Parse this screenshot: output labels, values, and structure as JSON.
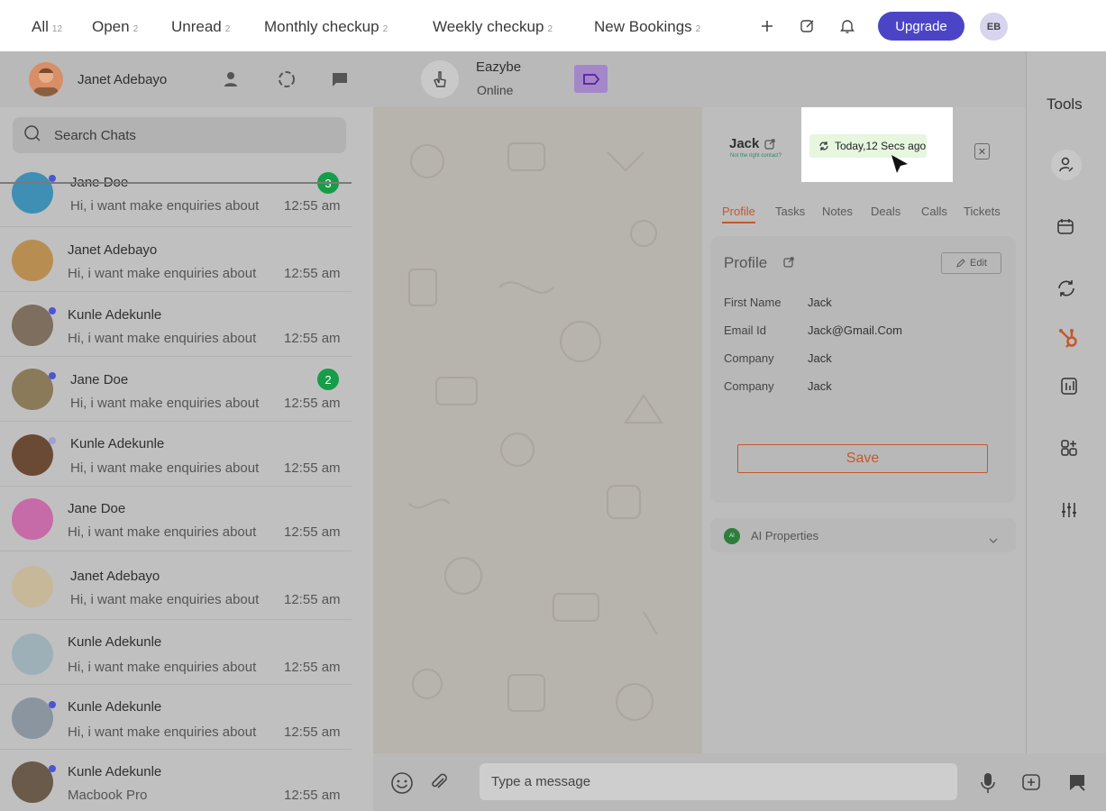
{
  "tabs": [
    {
      "label": "All",
      "count": "12"
    },
    {
      "label": "Open",
      "count": "2"
    },
    {
      "label": "Unread",
      "count": "2"
    },
    {
      "label": "Monthly checkup",
      "count": "2"
    },
    {
      "label": "Weekly checkup",
      "count": "2"
    },
    {
      "label": "New Bookings",
      "count": "2"
    }
  ],
  "topbar": {
    "upgrade_label": "Upgrade",
    "avatar_initials": "EB"
  },
  "header": {
    "user_name": "Janet Adebayo",
    "contact_name": "Eazybe",
    "contact_status": "Online"
  },
  "search": {
    "placeholder": "Search Chats"
  },
  "chats": [
    {
      "name": "Jane Doe",
      "message": "Hi, i want make enquiries about",
      "time": "12:55 am",
      "unread": "3"
    },
    {
      "name": "Janet Adebayo",
      "message": "Hi, i want make enquiries about",
      "time": "12:55 am",
      "unread": ""
    },
    {
      "name": "Kunle Adekunle",
      "message": "Hi, i want make enquiries about",
      "time": "12:55 am",
      "unread": ""
    },
    {
      "name": "Jane Doe",
      "message": "Hi, i want make enquiries about",
      "time": "12:55 am",
      "unread": "2"
    },
    {
      "name": "Kunle Adekunle",
      "message": "Hi, i want make enquiries about",
      "time": "12:55 am",
      "unread": ""
    },
    {
      "name": "Jane Doe",
      "message": "Hi, i want make enquiries about",
      "time": "12:55 am",
      "unread": ""
    },
    {
      "name": "Janet Adebayo",
      "message": "Hi, i want make enquiries about",
      "time": "12:55 am",
      "unread": ""
    },
    {
      "name": "Kunle Adekunle",
      "message": "Hi, i want make enquiries about",
      "time": "12:55 am",
      "unread": ""
    },
    {
      "name": "Kunle Adekunle",
      "message": "Hi, i want make enquiries about",
      "time": "12:55 am",
      "unread": ""
    },
    {
      "name": "Kunle Adekunle",
      "message": "Macbook Pro",
      "time": "12:55 am",
      "unread": ""
    }
  ],
  "contact_panel": {
    "name": "Jack",
    "not_right": "Not the right contact?",
    "sync_text": "Today,12 Secs ago",
    "tabs": [
      "Profile",
      "Tasks",
      "Notes",
      "Deals",
      "Calls",
      "Tickets"
    ],
    "profile_title": "Profile",
    "edit_label": "Edit",
    "fields": [
      {
        "label": "First Name",
        "value": "Jack"
      },
      {
        "label": "Email Id",
        "value": "Jack@Gmail.Com"
      },
      {
        "label": "Company",
        "value": "Jack"
      },
      {
        "label": "Company",
        "value": "Jack"
      }
    ],
    "save_label": "Save",
    "ai_badge": "AI",
    "ai_label": "AI Properties"
  },
  "tools": {
    "title": "Tools"
  },
  "composer": {
    "placeholder": "Type a message"
  },
  "colors": {
    "accent": "#4b45c6",
    "brand_orange": "#c4582c",
    "unread_green": "#169d47"
  }
}
